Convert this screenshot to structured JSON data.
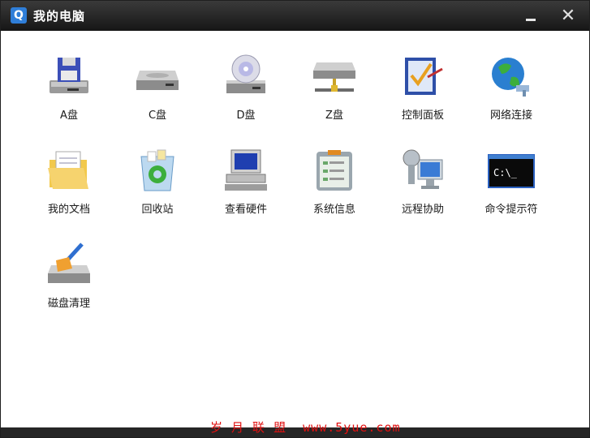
{
  "window": {
    "title": "我的电脑",
    "app_icon_letter": "Q",
    "close_glyph": "✕"
  },
  "items": [
    {
      "label": "A盘",
      "icon": "floppy-drive-icon"
    },
    {
      "label": "C盘",
      "icon": "hard-drive-icon"
    },
    {
      "label": "D盘",
      "icon": "cd-drive-icon"
    },
    {
      "label": "Z盘",
      "icon": "network-drive-icon"
    },
    {
      "label": "控制面板",
      "icon": "control-panel-icon"
    },
    {
      "label": "网络连接",
      "icon": "network-globe-icon"
    },
    {
      "label": "我的文档",
      "icon": "documents-folder-icon"
    },
    {
      "label": "回收站",
      "icon": "recycle-bin-icon"
    },
    {
      "label": "查看硬件",
      "icon": "computer-icon"
    },
    {
      "label": "系统信息",
      "icon": "system-info-icon"
    },
    {
      "label": "远程协助",
      "icon": "remote-assist-icon"
    },
    {
      "label": "命令提示符",
      "icon": "command-prompt-icon"
    },
    {
      "label": "磁盘清理",
      "icon": "disk-cleanup-icon"
    }
  ],
  "watermark": "岁 月 联 盟  www.5yue.com",
  "colors": {
    "titlebar": "#1e1e1e",
    "accent": "#2f7ed8",
    "watermark": "#e01010"
  }
}
